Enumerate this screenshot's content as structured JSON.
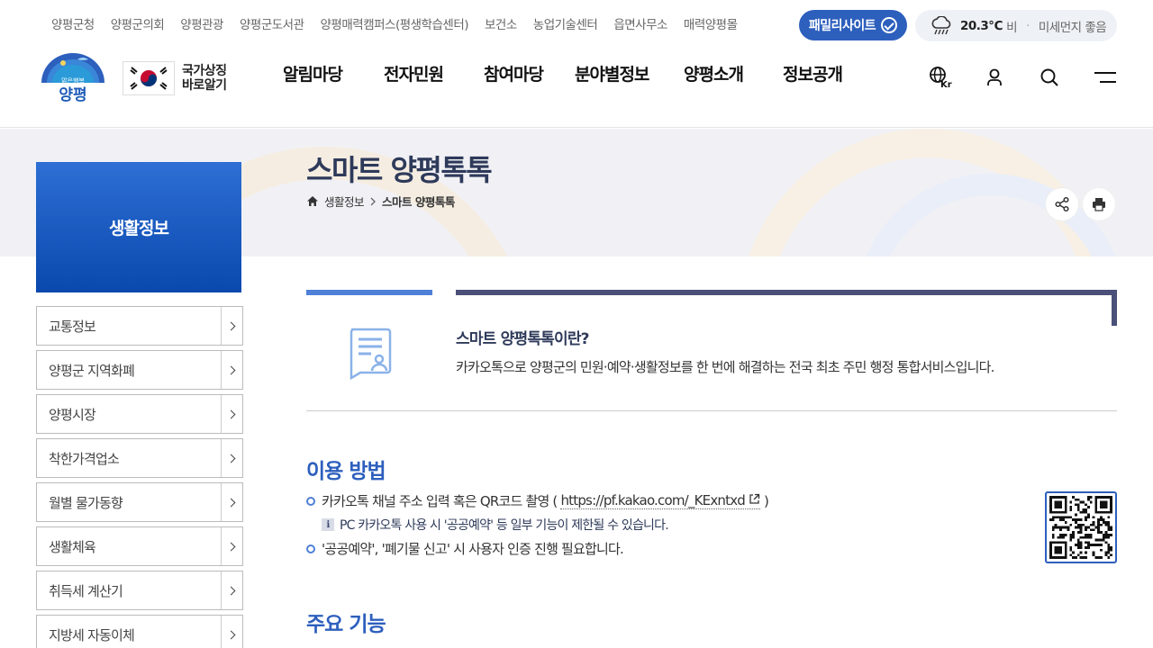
{
  "top_links": [
    "양평군청",
    "양평군의회",
    "양평관광",
    "양평군도서관",
    "양평매력캠퍼스(평생학습센터)",
    "보건소",
    "농업기술센터",
    "읍면사무소",
    "매력양평몰"
  ],
  "family_site_label": "패밀리사이트",
  "weather": {
    "temp": "20.3℃",
    "condition": "비",
    "dust": "미세먼지 좋음"
  },
  "logo": {
    "tagline": "맑은행복",
    "name": "양평"
  },
  "national_symbol": {
    "line1": "국가상징",
    "line2": "바로알기"
  },
  "gnb": [
    "알림마당",
    "전자민원",
    "참여마당",
    "분야별정보",
    "양평소개",
    "정보공개"
  ],
  "header_icons": {
    "language_label": "Kr"
  },
  "page": {
    "title": "스마트 양평톡톡",
    "breadcrumb": [
      "생활정보",
      "스마트 양평톡톡"
    ]
  },
  "sidebar": {
    "title": "생활정보",
    "items": [
      "교통정보",
      "양평군 지역화폐",
      "양평시장",
      "착한가격업소",
      "월별 물가동향",
      "생활체육",
      "취득세 계산기",
      "지방세 자동이체"
    ]
  },
  "intro": {
    "heading": "스마트 양평톡톡이란?",
    "text": "카카오톡으로 양평군의 민원·예약·생활정보를 한 번에 해결하는 전국 최초 주민 행정 통합서비스입니다."
  },
  "usage": {
    "title": "이용 방법",
    "bullet1_prefix": "카카오톡 채널 주소 입력 혹은 QR코드 촬영 (",
    "bullet1_link": "https://pf.kakao.com/_KExntxd",
    "bullet1_suffix": ")",
    "note_icon": "i",
    "note": "PC 카카오톡 사용 시 '공공예약' 등 일부 기능이 제한될 수 있습니다.",
    "bullet2": "'공공예약', '폐기물 신고' 시 사용자 인증 진행 필요합니다."
  },
  "features": {
    "title": "주요 기능"
  },
  "colors": {
    "primary": "#2d5fbd",
    "navy": "#2e3a5a",
    "accent": "#4f7fd6"
  }
}
